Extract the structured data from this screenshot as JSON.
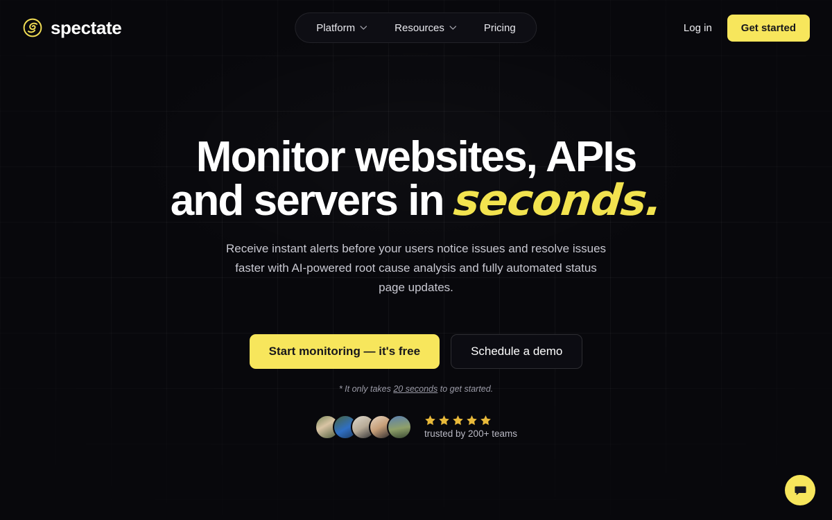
{
  "brand": {
    "name": "spectate",
    "logo_icon": "spiral-swirl-icon",
    "accent_color": "#F7E65C",
    "background_color": "#08080c"
  },
  "header": {
    "nav": [
      {
        "label": "Platform",
        "icon": "chevron-down-icon",
        "has_dropdown": true
      },
      {
        "label": "Resources",
        "icon": "chevron-down-icon",
        "has_dropdown": true
      },
      {
        "label": "Pricing",
        "icon": "",
        "has_dropdown": false
      }
    ],
    "login_label": "Log in",
    "get_started_label": "Get started"
  },
  "hero": {
    "headline_line1": "Monitor websites, APIs",
    "headline_line2_plain": "and servers in ",
    "headline_line2_accent": "seconds.",
    "subtitle": "Receive instant alerts before your users notice issues and resolve issues faster with AI-powered root cause analysis and fully automated status page updates.",
    "primary_cta": "Start monitoring — it's free",
    "secondary_cta": "Schedule a demo",
    "fineprint_before": "* It only takes ",
    "fineprint_underlined": "20 seconds",
    "fineprint_after": " to get started."
  },
  "social_proof": {
    "avatar_count": 5,
    "star_count": 5,
    "star_color": "#E8B93A",
    "trusted_label": "trusted by 200+ teams"
  },
  "chat": {
    "icon": "chat-bubble-icon",
    "color": "#F7E65C"
  }
}
